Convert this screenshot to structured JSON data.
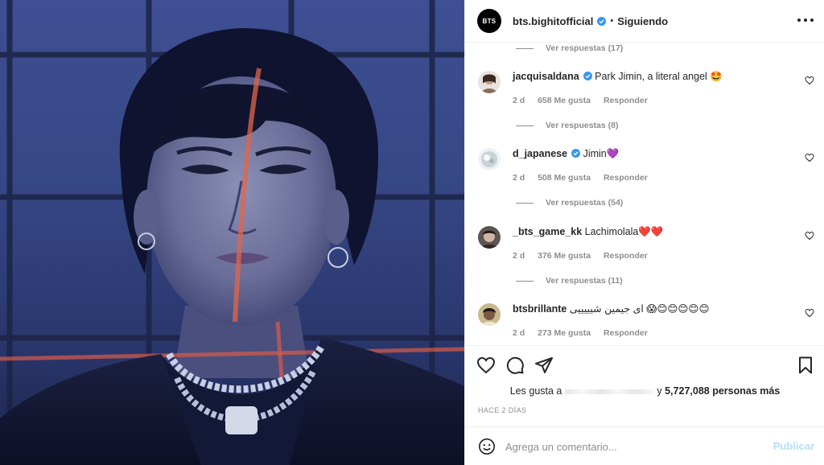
{
  "post": {
    "photo_icon": "portrait-photo"
  },
  "header": {
    "avatar_text": "BTS",
    "username": "bts.bighitofficial",
    "dot": "•",
    "follow_status": "Siguiendo",
    "more_icon": "more-horizontal-icon"
  },
  "comments": {
    "top_replies": "Ver respuestas (17)",
    "items": [
      {
        "username": "jacquisaldana",
        "verified": true,
        "text": "Park Jimin, a literal angel 🤩",
        "age": "2 d",
        "likes": "658 Me gusta",
        "reply": "Responder",
        "replies": "Ver respuestas (8)"
      },
      {
        "username": "d_japanese",
        "verified": true,
        "text": "Jimin💜",
        "age": "2 d",
        "likes": "508 Me gusta",
        "reply": "Responder",
        "replies": "Ver respuestas (54)"
      },
      {
        "username": "_bts_game_kk",
        "verified": false,
        "text": "Lachimolala❤️❤️",
        "age": "2 d",
        "likes": "376 Me gusta",
        "reply": "Responder",
        "replies": "Ver respuestas (11)"
      },
      {
        "username": "btsbrillante",
        "verified": false,
        "text": "ای جیمین شیییییی 😱😊😊😊😊😊",
        "age": "2 d",
        "likes": "273 Me gusta",
        "reply": "Responder"
      }
    ]
  },
  "actions": {
    "like_icon": "heart-icon",
    "comment_icon": "comment-icon",
    "share_icon": "send-icon",
    "save_icon": "bookmark-icon"
  },
  "likes": {
    "prefix": "Les gusta a",
    "suffix_y": "y",
    "count_text": "5,727,088 personas más"
  },
  "date": "HACE 2 DÍAS",
  "comment_box": {
    "placeholder": "Agrega un comentario...",
    "publish_label": "Publicar"
  },
  "colors": {
    "verified": "#3897f0",
    "muted": "#8e8e8e",
    "publish_disabled": "#b2dffc"
  }
}
